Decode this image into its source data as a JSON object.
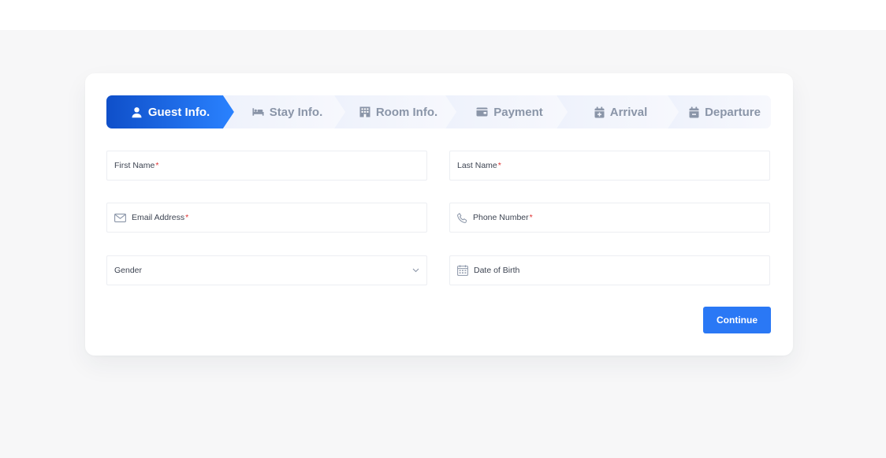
{
  "steps": [
    {
      "label": "Guest Info.",
      "icon": "user-icon",
      "active": true
    },
    {
      "label": "Stay Info.",
      "icon": "bed-icon",
      "active": false
    },
    {
      "label": "Room Info.",
      "icon": "building-icon",
      "active": false
    },
    {
      "label": "Payment",
      "icon": "wallet-icon",
      "active": false
    },
    {
      "label": "Arrival",
      "icon": "calendar-plus-icon",
      "active": false
    },
    {
      "label": "Departure",
      "icon": "calendar-minus-icon",
      "active": false
    }
  ],
  "form": {
    "first_name": {
      "label": "First Name",
      "required": "*"
    },
    "last_name": {
      "label": "Last Name",
      "required": "*"
    },
    "email": {
      "label": "Email Address",
      "required": "*",
      "icon": "mail-icon"
    },
    "phone": {
      "label": "Phone Number",
      "required": "*",
      "icon": "phone-icon"
    },
    "gender": {
      "label": "Gender",
      "icon": "chevron-down-icon"
    },
    "dob": {
      "label": "Date of Birth",
      "icon": "calendar-icon"
    }
  },
  "actions": {
    "continue_label": "Continue"
  },
  "colors": {
    "accent": "#2a78f5",
    "active_step_start": "#0f4fc9",
    "active_step_end": "#2a82ff",
    "inactive_step_text": "#8a95a8",
    "required": "#e03131",
    "page_background": "#f7f7f8"
  }
}
